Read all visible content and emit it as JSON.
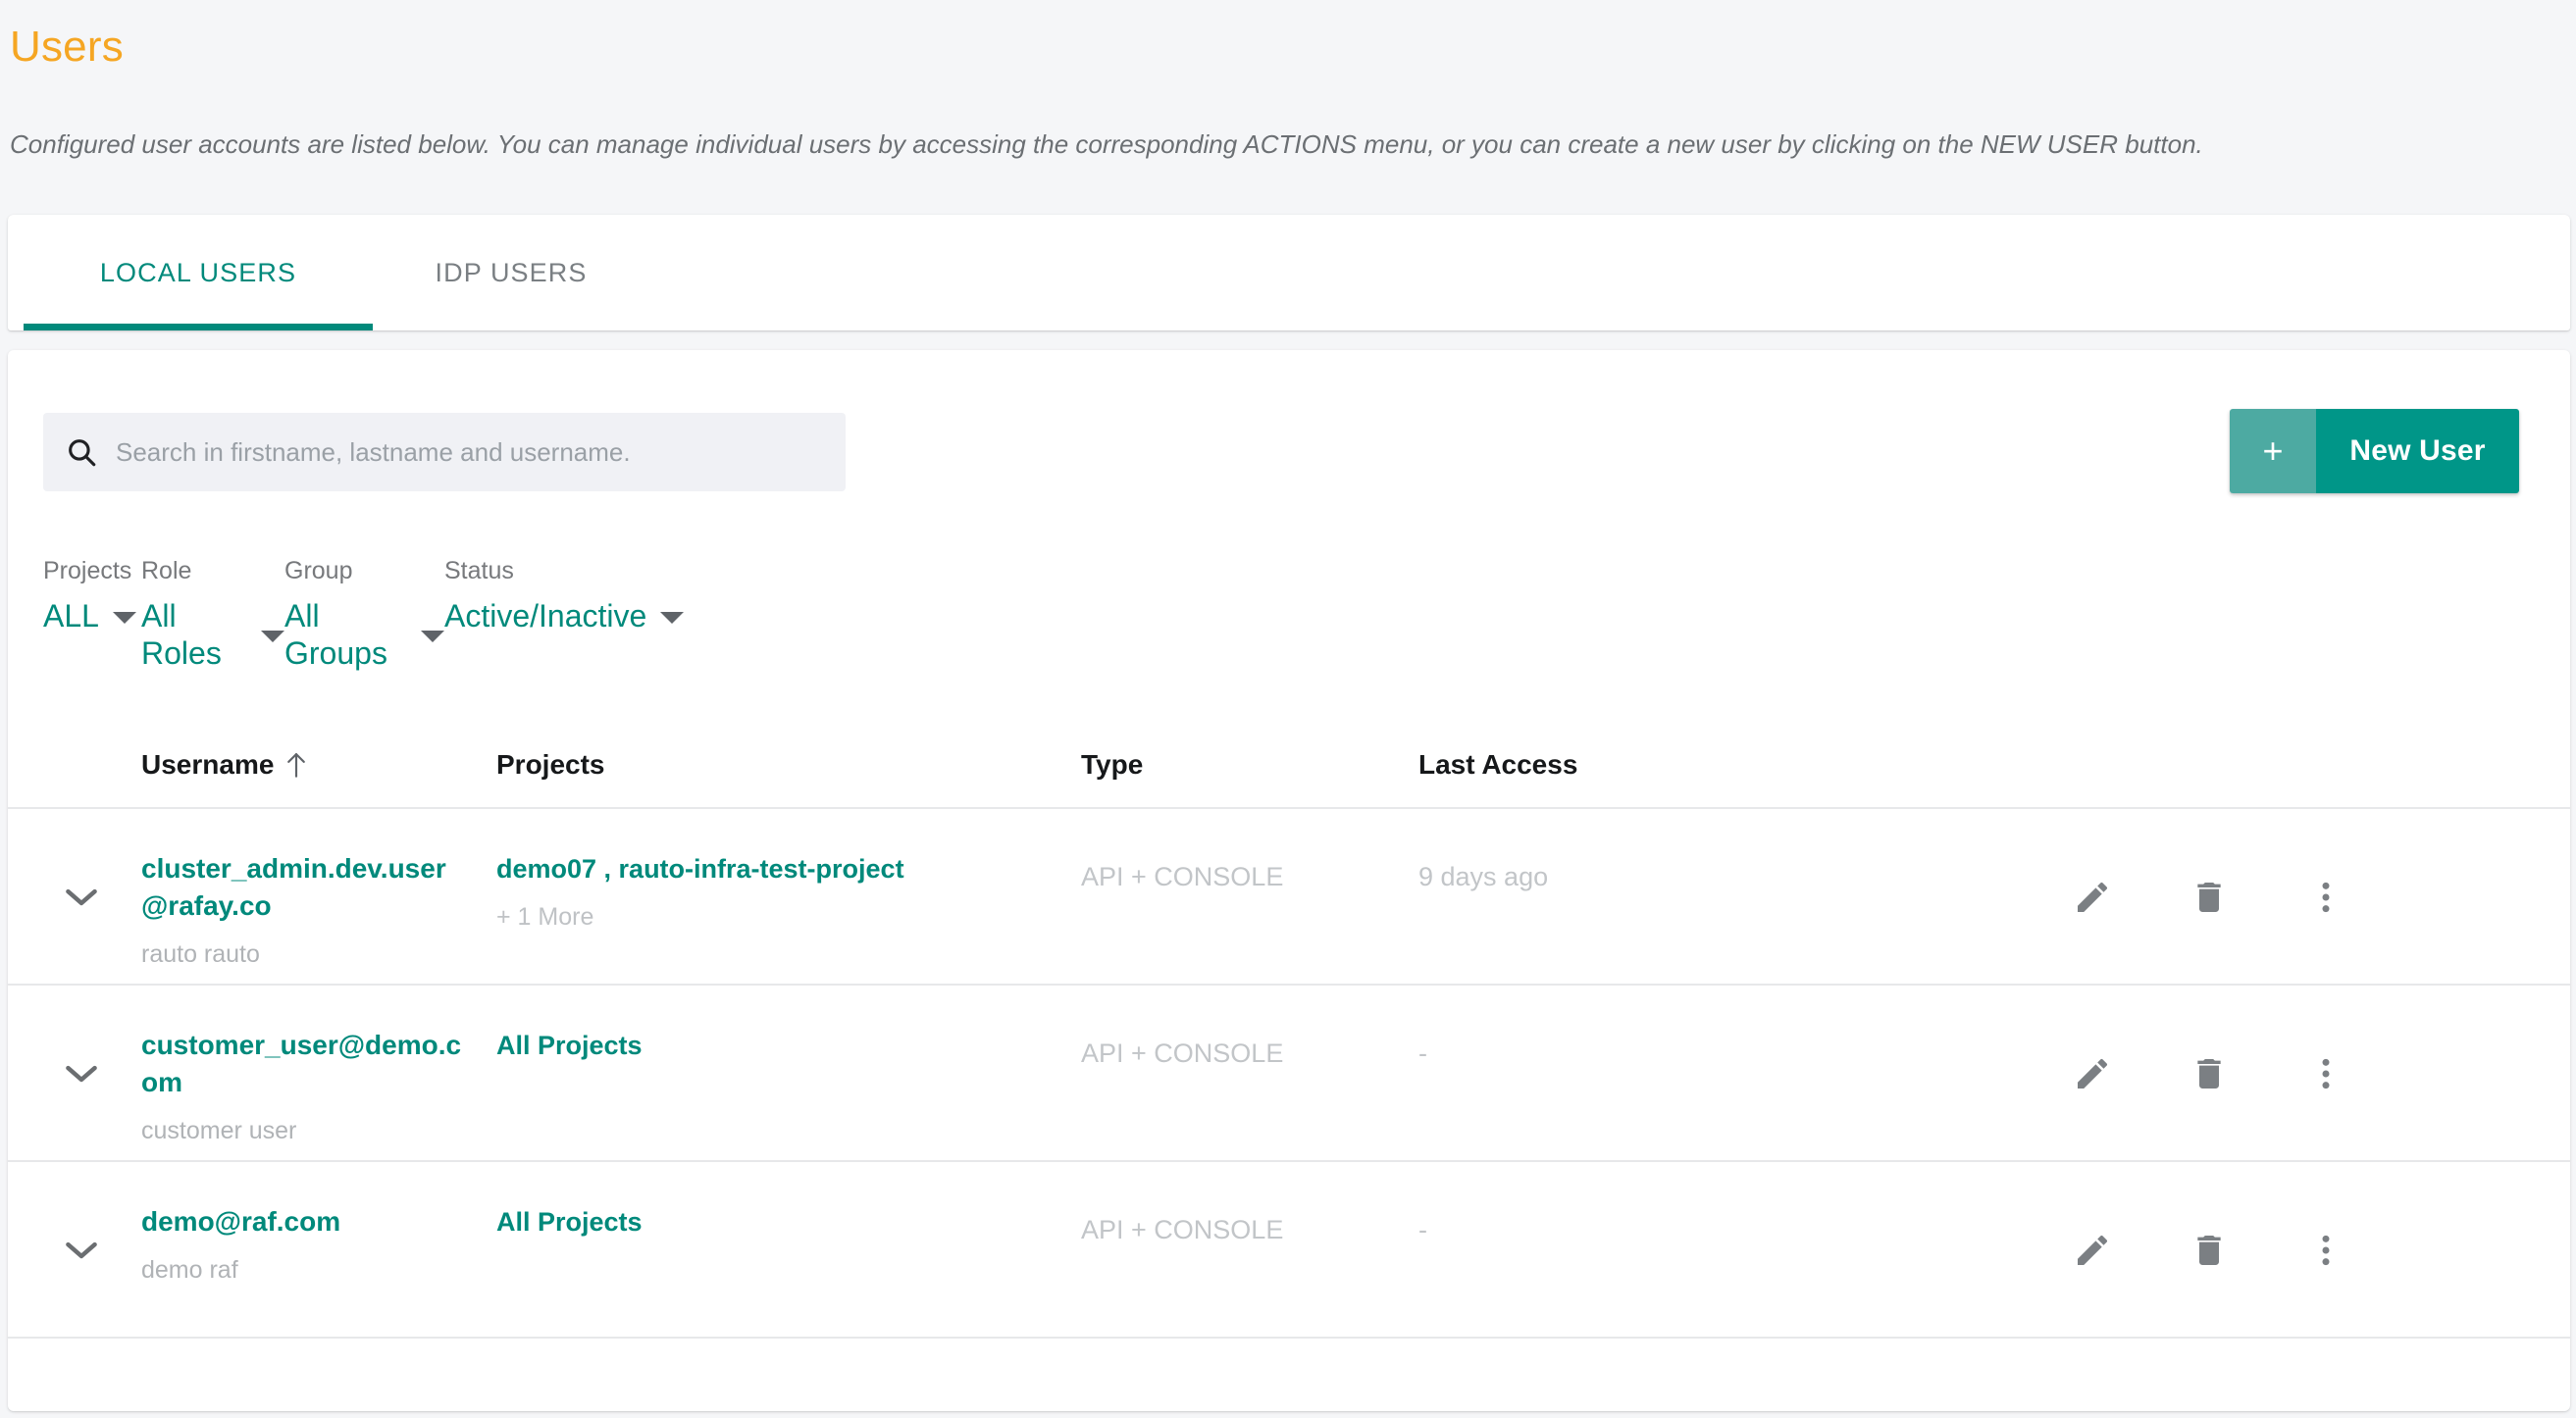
{
  "header": {
    "title": "Users",
    "description": "Configured user accounts are listed below. You can manage individual users by accessing the corresponding ACTIONS menu, or you can create a new user by clicking on the NEW USER button.",
    "title_color": "#f5a623"
  },
  "tabs": [
    {
      "label": "LOCAL USERS",
      "active": true
    },
    {
      "label": "IDP USERS",
      "active": false
    }
  ],
  "toolbar": {
    "search": {
      "value": "",
      "placeholder": "Search in firstname, lastname and username.",
      "icon": "search-icon"
    },
    "new_user": {
      "plus": "+",
      "label": "New User",
      "plus_bg": "#4daaa2",
      "label_bg": "#009688"
    }
  },
  "filters": [
    {
      "label": "Projects",
      "value": "ALL"
    },
    {
      "label": "Role",
      "value": "All Roles"
    },
    {
      "label": "Group",
      "value": "All Groups"
    },
    {
      "label": "Status",
      "value": "Active/Inactive"
    }
  ],
  "table": {
    "columns": {
      "username": "Username",
      "projects": "Projects",
      "type": "Type",
      "last_access": "Last Access"
    },
    "sort": {
      "column": "username",
      "direction": "asc",
      "icon": "arrow-up-icon"
    },
    "rows": [
      {
        "username": "cluster_admin.dev.user@rafay.co",
        "fullname": "rauto rauto",
        "projects": "demo07 , rauto-infra-test-project",
        "projects_more": "+ 1 More",
        "type": "API + CONSOLE",
        "last_access": "9 days ago"
      },
      {
        "username": "customer_user@demo.com",
        "fullname": "customer user",
        "projects": "All Projects",
        "projects_more": "",
        "type": "API + CONSOLE",
        "last_access": "-"
      },
      {
        "username": "demo@raf.com",
        "fullname": "demo raf",
        "projects": "All Projects",
        "projects_more": "",
        "type": "API + CONSOLE",
        "last_access": "-"
      }
    ],
    "row_actions": [
      {
        "name": "edit-icon",
        "title": "Edit"
      },
      {
        "name": "delete-icon",
        "title": "Delete"
      },
      {
        "name": "more-vertical-icon",
        "title": "More actions"
      }
    ],
    "expand_icon": "chevron-down-icon"
  },
  "colors": {
    "accent_teal": "#00897b",
    "page_bg": "#f5f6f8",
    "card_bg": "#ffffff",
    "muted_text": "#c2c5c8",
    "divider": "#e7e8ea"
  }
}
